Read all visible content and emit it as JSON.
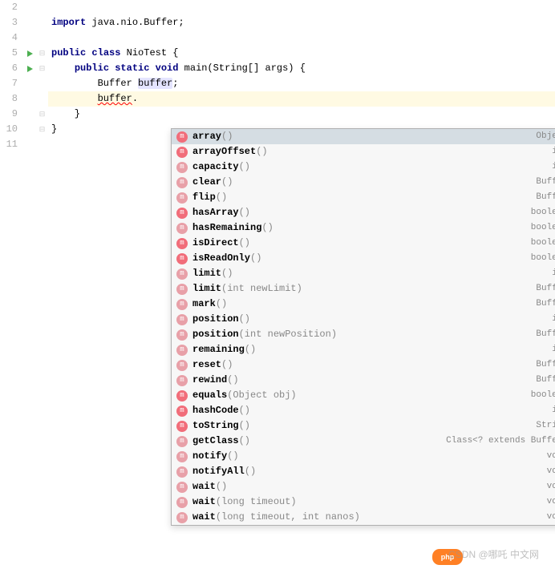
{
  "gutter_lines": [
    "2",
    "3",
    "4",
    "5",
    "6",
    "7",
    "8",
    "9",
    "10",
    "11"
  ],
  "run_markers": [
    3,
    4
  ],
  "fold_markers": {
    "3": "⊟",
    "4": "⊟",
    "7": "⊟",
    "8": "⊟"
  },
  "code": {
    "line2": "",
    "line3_import": "import",
    "line3_rest": " java.nio.Buffer;",
    "line4": "",
    "line5_public": "public",
    "line5_class": "class",
    "line5_name": " NioTest {",
    "line6_indent": "    ",
    "line6_public": "public",
    "line6_static": "static",
    "line6_void": "void",
    "line6_main": " main(String[] args) {",
    "line7_indent": "        ",
    "line7_type": "Buffer ",
    "line7_var": "buffer",
    "line7_end": ";",
    "line8_indent": "        ",
    "line8_var": "buffer",
    "line8_dot": ".",
    "line9": "    }",
    "line10": "}",
    "line11": ""
  },
  "completion": [
    {
      "name": "array",
      "params": "()",
      "ret": "Object",
      "locked": false,
      "sel": true
    },
    {
      "name": "arrayOffset",
      "params": "()",
      "ret": "int",
      "locked": false
    },
    {
      "name": "capacity",
      "params": "()",
      "ret": "int",
      "locked": true
    },
    {
      "name": "clear",
      "params": "()",
      "ret": "Buffer",
      "locked": true
    },
    {
      "name": "flip",
      "params": "()",
      "ret": "Buffer",
      "locked": true
    },
    {
      "name": "hasArray",
      "params": "()",
      "ret": "boolean",
      "locked": false
    },
    {
      "name": "hasRemaining",
      "params": "()",
      "ret": "boolean",
      "locked": true
    },
    {
      "name": "isDirect",
      "params": "()",
      "ret": "boolean",
      "locked": false
    },
    {
      "name": "isReadOnly",
      "params": "()",
      "ret": "boolean",
      "locked": false
    },
    {
      "name": "limit",
      "params": "()",
      "ret": "int",
      "locked": true
    },
    {
      "name": "limit",
      "params": "(int newLimit)",
      "ret": "Buffer",
      "locked": true
    },
    {
      "name": "mark",
      "params": "()",
      "ret": "Buffer",
      "locked": true
    },
    {
      "name": "position",
      "params": "()",
      "ret": "int",
      "locked": true
    },
    {
      "name": "position",
      "params": "(int newPosition)",
      "ret": "Buffer",
      "locked": true
    },
    {
      "name": "remaining",
      "params": "()",
      "ret": "int",
      "locked": true
    },
    {
      "name": "reset",
      "params": "()",
      "ret": "Buffer",
      "locked": true
    },
    {
      "name": "rewind",
      "params": "()",
      "ret": "Buffer",
      "locked": true
    },
    {
      "name": "equals",
      "params": "(Object obj)",
      "ret": "boolean",
      "locked": false
    },
    {
      "name": "hashCode",
      "params": "()",
      "ret": "int",
      "locked": false
    },
    {
      "name": "toString",
      "params": "()",
      "ret": "String",
      "locked": false
    },
    {
      "name": "getClass",
      "params": "()",
      "ret": "Class<? extends Buffer>",
      "locked": true
    },
    {
      "name": "notify",
      "params": "()",
      "ret": "void",
      "locked": true
    },
    {
      "name": "notifyAll",
      "params": "()",
      "ret": "void",
      "locked": true
    },
    {
      "name": "wait",
      "params": "()",
      "ret": "void",
      "locked": true
    },
    {
      "name": "wait",
      "params": "(long timeout)",
      "ret": "void",
      "locked": true
    },
    {
      "name": "wait",
      "params": "(long timeout, int nanos)",
      "ret": "void",
      "locked": true
    }
  ],
  "method_icon_letter": "m",
  "watermark": {
    "csdn": "CSDN @哪吒",
    "site": "中文网",
    "logo": "php"
  }
}
